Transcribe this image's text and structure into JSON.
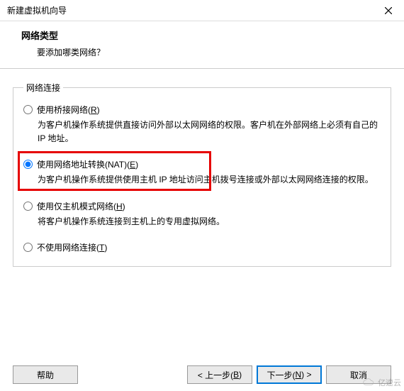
{
  "window": {
    "title": "新建虚拟机向导",
    "close_label": "关闭"
  },
  "header": {
    "heading": "网络类型",
    "subheading": "要添加哪类网络？"
  },
  "group_legend": "网络连接",
  "options": {
    "bridged": {
      "label_pre": "使用桥接网络(",
      "accel": "R",
      "label_post": ")",
      "desc": "为客户机操作系统提供直接访问外部以太网网络的权限。客户机在外部网络上必须有自己的 IP 地址。"
    },
    "nat": {
      "label_pre": "使用网络地址转换(NAT)(",
      "accel": "E",
      "label_post": ")",
      "desc": "为客户机操作系统提供使用主机 IP 地址访问主机拨号连接或外部以太网网络连接的权限。"
    },
    "hostonly": {
      "label_pre": "使用仅主机模式网络(",
      "accel": "H",
      "label_post": ")",
      "desc": "将客户机操作系统连接到主机上的专用虚拟网络。"
    },
    "none": {
      "label_pre": "不使用网络连接(",
      "accel": "T",
      "label_post": ")"
    }
  },
  "buttons": {
    "help": "帮助",
    "back_pre": "< 上一步(",
    "back_accel": "B",
    "back_post": ")",
    "next_pre": "下一步(",
    "next_accel": "N",
    "next_post": ") >",
    "cancel": "取消"
  },
  "watermark": "亿速云"
}
